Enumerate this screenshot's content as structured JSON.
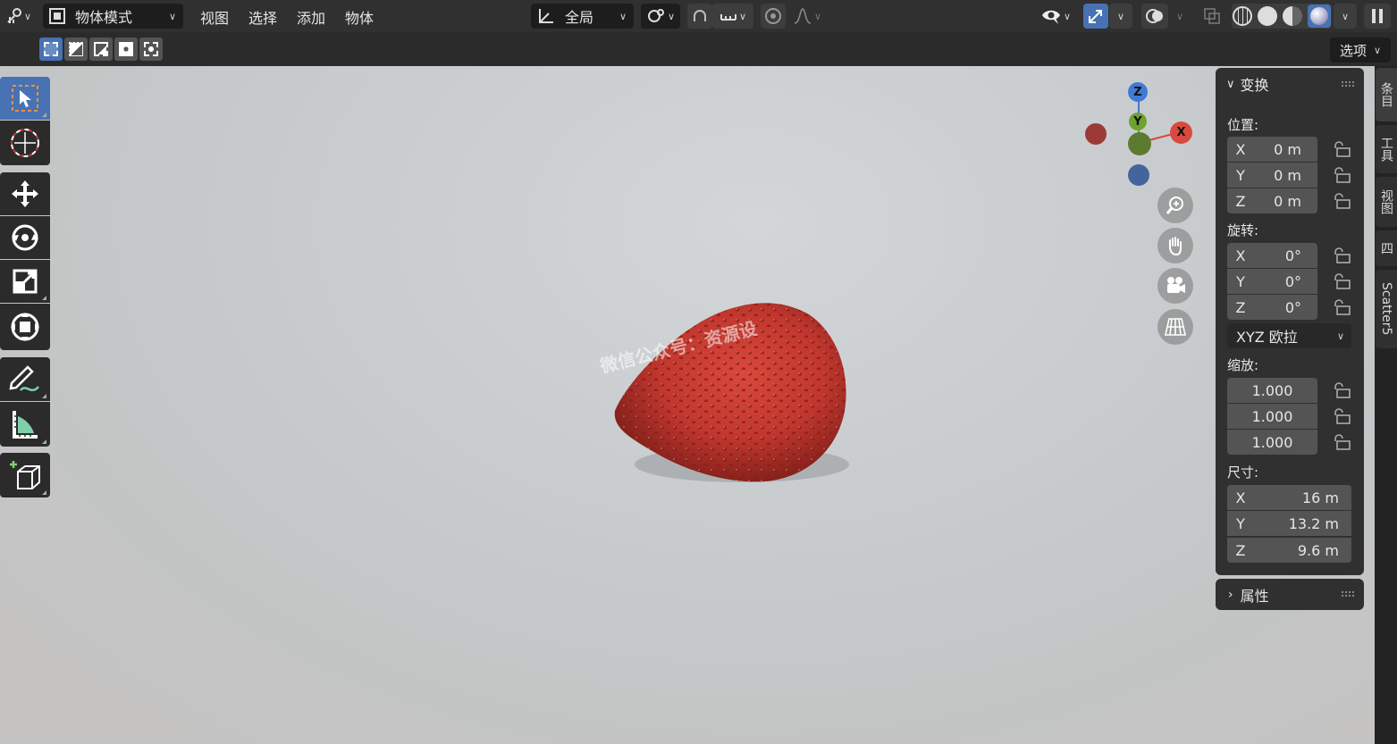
{
  "header": {
    "mode_label": "物体模式",
    "menus": [
      "视图",
      "选择",
      "添加",
      "物体"
    ],
    "orientation_label": "全局"
  },
  "subbar": {
    "options_label": "选项"
  },
  "npanel": {
    "title": "变换",
    "location_label": "位置:",
    "location": [
      {
        "axis": "X",
        "value": "0 m"
      },
      {
        "axis": "Y",
        "value": "0 m"
      },
      {
        "axis": "Z",
        "value": "0 m"
      }
    ],
    "rotation_label": "旋转:",
    "rotation": [
      {
        "axis": "X",
        "value": "0°"
      },
      {
        "axis": "Y",
        "value": "0°"
      },
      {
        "axis": "Z",
        "value": "0°"
      }
    ],
    "rotation_mode": "XYZ 欧拉",
    "scale_label": "缩放:",
    "scale": [
      "1.000",
      "1.000",
      "1.000"
    ],
    "dimensions_label": "尺寸:",
    "dimensions": [
      {
        "axis": "X",
        "value": "16 m"
      },
      {
        "axis": "Y",
        "value": "13.2 m"
      },
      {
        "axis": "Z",
        "value": "9.6 m"
      }
    ],
    "properties_label": "属性"
  },
  "right_tabs": [
    "条目",
    "工具",
    "视图",
    "四",
    "Scatter5"
  ],
  "gizmo": {
    "x": "X",
    "y": "Y",
    "z": "Z"
  },
  "watermark": "微信公众号：资源设"
}
